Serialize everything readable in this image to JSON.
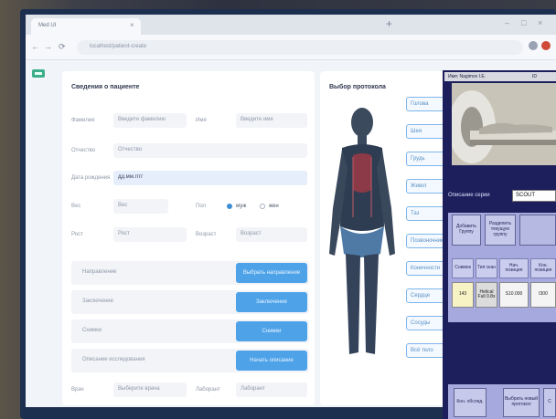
{
  "browser": {
    "tab_title": "Med UI",
    "tab_close": "×",
    "new_tab": "+",
    "controls": [
      "–",
      "□",
      "×"
    ],
    "nav": [
      "←",
      "→",
      "⟳"
    ],
    "url": "localhost/patient-create"
  },
  "patient_form": {
    "title": "Сведения о пациенте",
    "fields": [
      {
        "label": "Фамилия",
        "value": "Введите фамилию"
      },
      {
        "label": "Имя",
        "value": "Введите имя"
      },
      {
        "label": "Отчество",
        "value": "Отчество"
      },
      {
        "label": "Дата рождения",
        "value": "дд.мм.гггг"
      },
      {
        "label": "Вес",
        "value": "Вес"
      },
      {
        "label": "Рост",
        "value": "Рост"
      },
      {
        "label": "Возраст",
        "value": "Возраст"
      }
    ],
    "gender_label": "Пол",
    "gender_options": [
      "муж",
      "жен"
    ],
    "sections": [
      {
        "label": "Направление",
        "button": "Выбрать направление"
      },
      {
        "label": "Заключение",
        "button": "Заключение"
      },
      {
        "label": "Снимки",
        "button": "Снимки"
      },
      {
        "label": "Описание исследования",
        "button": "Начать описание"
      }
    ],
    "footer_fields": [
      {
        "label": "Врач",
        "value": "Выберите врача"
      },
      {
        "label": "Лаборант",
        "value": "Лаборант"
      }
    ]
  },
  "protocol_panel": {
    "title": "Выбор протокола",
    "buttons": [
      "Голова",
      "Шея",
      "Грудь",
      "Живот",
      "Таз",
      "Позвоночник",
      "Конечности",
      "Сердце",
      "Сосуды",
      "Всё тело"
    ]
  },
  "scanner_window": {
    "patient_name": "Имя: Nagimov I.E.",
    "id_label": "ID",
    "series_desc_label": "Описание серии",
    "series_desc_value": "SCOUT",
    "group_buttons": [
      "Добавить Группу",
      "Разделить текущую группу"
    ],
    "table_headers": [
      "Снимок",
      "Тип скан",
      "Нач. позиция",
      "Кон. позиция"
    ],
    "table_row": [
      "143",
      "Helical Full 0.8s",
      "S10.000",
      "I300"
    ],
    "bottom_buttons": [
      "Кон. обслед.",
      "Выбрать новый протокол",
      "С"
    ]
  }
}
